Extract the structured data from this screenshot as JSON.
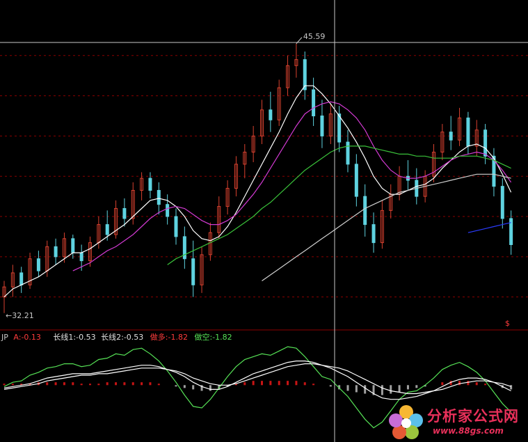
{
  "colors": {
    "background": "#000000",
    "grid": "#8b0000",
    "candle_up": "#d8412f",
    "candle_down": "#5fd3e0",
    "ma_white": "#ffffff",
    "ma_magenta": "#d23ad2",
    "ma_green": "#3ac23a",
    "ma_long": "#d0d0d0",
    "ma_blue": "#2b3cff",
    "macd_white": "#ffffff",
    "macd_green": "#56e256",
    "macd_red": "#ff2020",
    "bar_up": "#c81414",
    "bar_down": "#a0a0a0",
    "crosshair": "#c8c8c8",
    "ind_name": "#c8c8c8",
    "ind_red": "#ff3c3c",
    "ind_white": "#e0e0e0",
    "ind_green": "#56e256"
  },
  "price_labels": {
    "high": "45.59",
    "low": "←32.21",
    "marker": "$"
  },
  "indicator": {
    "name": "JP",
    "a_label": "A:",
    "a_value": "-0.13",
    "long1_label": "长线1:",
    "long1_value": "-0.53",
    "long2_label": "长线2:",
    "long2_value": "-0.53",
    "long_pos_label": "做多:",
    "long_pos_value": "-1.82",
    "short_pos_label": "做空:",
    "short_pos_value": "-1.82"
  },
  "logo": {
    "name": "分析家公式网",
    "url": "www.88gs.com",
    "icon": "flower-logo-icon"
  },
  "chart_data": [
    {
      "type": "candlestick",
      "title": "",
      "ylim": [
        31.5,
        47.0
      ],
      "price_high": 45.59,
      "price_low": 32.21,
      "candles": [
        [
          33.0,
          33.8,
          32.2,
          33.5
        ],
        [
          33.5,
          34.6,
          33.0,
          34.2
        ],
        [
          34.2,
          34.5,
          33.2,
          33.6
        ],
        [
          33.6,
          35.2,
          33.4,
          34.9
        ],
        [
          34.9,
          35.3,
          34.0,
          34.3
        ],
        [
          34.3,
          35.8,
          34.0,
          35.5
        ],
        [
          35.5,
          35.9,
          34.6,
          35.0
        ],
        [
          35.0,
          36.2,
          34.7,
          35.9
        ],
        [
          35.9,
          36.1,
          34.9,
          35.2
        ],
        [
          35.2,
          35.6,
          34.3,
          34.8
        ],
        [
          34.8,
          36.0,
          34.5,
          35.7
        ],
        [
          35.7,
          37.0,
          35.4,
          36.6
        ],
        [
          36.6,
          37.3,
          35.8,
          36.1
        ],
        [
          36.1,
          37.8,
          35.9,
          37.4
        ],
        [
          37.4,
          37.9,
          36.5,
          36.9
        ],
        [
          36.9,
          38.7,
          36.6,
          38.3
        ],
        [
          38.3,
          39.2,
          37.8,
          38.9
        ],
        [
          38.9,
          39.2,
          37.9,
          38.3
        ],
        [
          38.3,
          38.7,
          37.1,
          37.6
        ],
        [
          37.6,
          38.1,
          36.6,
          37.0
        ],
        [
          37.0,
          37.4,
          35.6,
          36.0
        ],
        [
          36.0,
          36.5,
          34.4,
          34.9
        ],
        [
          34.9,
          35.8,
          33.0,
          33.6
        ],
        [
          33.6,
          35.5,
          33.2,
          35.1
        ],
        [
          35.1,
          36.7,
          34.8,
          36.2
        ],
        [
          36.2,
          38.0,
          35.9,
          37.5
        ],
        [
          37.5,
          38.8,
          37.1,
          38.4
        ],
        [
          38.4,
          40.0,
          38.0,
          39.6
        ],
        [
          39.6,
          40.6,
          38.9,
          40.2
        ],
        [
          40.2,
          41.5,
          39.7,
          41.0
        ],
        [
          41.0,
          42.8,
          40.6,
          42.3
        ],
        [
          42.3,
          43.2,
          41.2,
          41.8
        ],
        [
          41.8,
          43.8,
          41.5,
          43.4
        ],
        [
          43.4,
          45.0,
          43.0,
          44.5
        ],
        [
          44.5,
          45.59,
          43.9,
          44.8
        ],
        [
          44.8,
          45.2,
          42.8,
          43.3
        ],
        [
          43.3,
          43.9,
          41.5,
          42.0
        ],
        [
          42.0,
          42.8,
          40.4,
          41.0
        ],
        [
          41.0,
          42.6,
          40.6,
          42.1
        ],
        [
          42.1,
          42.5,
          40.2,
          40.7
        ],
        [
          40.7,
          41.3,
          39.2,
          39.6
        ],
        [
          39.6,
          40.1,
          37.5,
          38.0
        ],
        [
          38.0,
          38.6,
          36.0,
          36.6
        ],
        [
          36.6,
          37.2,
          35.2,
          35.7
        ],
        [
          35.7,
          37.8,
          35.4,
          37.3
        ],
        [
          37.3,
          38.6,
          36.9,
          38.1
        ],
        [
          38.1,
          39.5,
          37.8,
          39.0
        ],
        [
          39.0,
          39.8,
          38.3,
          38.8
        ],
        [
          38.8,
          39.4,
          37.6,
          38.0
        ],
        [
          38.0,
          39.3,
          37.7,
          39.0
        ],
        [
          39.0,
          40.6,
          38.7,
          40.2
        ],
        [
          40.2,
          41.6,
          39.8,
          41.2
        ],
        [
          41.2,
          42.0,
          40.3,
          40.8
        ],
        [
          40.8,
          42.4,
          40.5,
          41.9
        ],
        [
          41.9,
          42.2,
          40.1,
          40.5
        ],
        [
          40.5,
          41.8,
          40.0,
          41.3
        ],
        [
          41.3,
          41.6,
          39.6,
          40.0
        ],
        [
          40.0,
          40.4,
          38.0,
          38.5
        ],
        [
          38.5,
          38.9,
          36.4,
          36.9
        ],
        [
          36.9,
          37.3,
          35.1,
          35.6
        ]
      ],
      "moving_averages": [
        {
          "color": "ma_white",
          "values": [
            33.0,
            33.4,
            33.6,
            33.8,
            34.0,
            34.3,
            34.6,
            34.9,
            35.2,
            35.2,
            35.4,
            35.7,
            36.0,
            36.3,
            36.6,
            37.0,
            37.4,
            37.8,
            37.9,
            37.8,
            37.5,
            37.0,
            36.3,
            35.9,
            35.8,
            36.0,
            36.5,
            37.2,
            38.0,
            38.8,
            39.6,
            40.4,
            41.2,
            42.1,
            42.9,
            43.5,
            43.5,
            43.1,
            42.6,
            42.0,
            41.4,
            40.7,
            39.9,
            39.0,
            38.4,
            38.1,
            38.1,
            38.3,
            38.5,
            38.6,
            38.9,
            39.4,
            39.8,
            40.2,
            40.5,
            40.6,
            40.4,
            39.9,
            39.1,
            38.2
          ]
        },
        {
          "color": "ma_magenta",
          "values": [
            null,
            null,
            null,
            null,
            null,
            null,
            null,
            null,
            34.3,
            34.5,
            34.7,
            35.0,
            35.3,
            35.5,
            35.8,
            36.1,
            36.5,
            36.9,
            37.2,
            37.4,
            37.5,
            37.4,
            37.1,
            36.8,
            36.6,
            36.6,
            36.8,
            37.1,
            37.6,
            38.1,
            38.7,
            39.4,
            40.1,
            40.8,
            41.5,
            42.1,
            42.4,
            42.6,
            42.7,
            42.6,
            42.3,
            41.9,
            41.3,
            40.5,
            39.8,
            39.3,
            39.0,
            38.9,
            38.9,
            39.0,
            39.2,
            39.5,
            39.8,
            40.0,
            40.1,
            40.2,
            40.1,
            39.8,
            39.3,
            38.7
          ]
        },
        {
          "color": "ma_green",
          "values": [
            null,
            null,
            null,
            null,
            null,
            null,
            null,
            null,
            null,
            null,
            null,
            null,
            null,
            null,
            null,
            null,
            null,
            null,
            null,
            34.6,
            34.9,
            35.1,
            35.3,
            35.5,
            35.7,
            35.9,
            36.1,
            36.4,
            36.7,
            37.0,
            37.4,
            37.7,
            38.1,
            38.5,
            38.9,
            39.3,
            39.6,
            39.9,
            40.2,
            40.4,
            40.5,
            40.5,
            40.5,
            40.4,
            40.3,
            40.2,
            40.1,
            40.1,
            40.0,
            40.0,
            39.9,
            39.9,
            39.9,
            40.0,
            40.0,
            40.0,
            39.9,
            39.8,
            39.6,
            39.4
          ]
        },
        {
          "color": "ma_long",
          "values": [
            null,
            null,
            null,
            null,
            null,
            null,
            null,
            null,
            null,
            null,
            null,
            null,
            null,
            null,
            null,
            null,
            null,
            null,
            null,
            null,
            null,
            null,
            null,
            null,
            null,
            null,
            null,
            null,
            null,
            null,
            33.8,
            34.1,
            34.4,
            34.7,
            35.0,
            35.3,
            35.6,
            35.9,
            36.2,
            36.5,
            36.8,
            37.1,
            37.4,
            37.6,
            37.8,
            38.0,
            38.2,
            38.3,
            38.4,
            38.5,
            38.6,
            38.7,
            38.8,
            38.9,
            39.0,
            39.1,
            39.1,
            39.1,
            39.0,
            38.9
          ]
        },
        {
          "color": "ma_blue",
          "values": [
            null,
            null,
            null,
            null,
            null,
            null,
            null,
            null,
            null,
            null,
            null,
            null,
            null,
            null,
            null,
            null,
            null,
            null,
            null,
            null,
            null,
            null,
            null,
            null,
            null,
            null,
            null,
            null,
            null,
            null,
            null,
            null,
            null,
            null,
            null,
            null,
            null,
            null,
            null,
            null,
            null,
            null,
            null,
            null,
            null,
            null,
            null,
            null,
            null,
            null,
            null,
            null,
            null,
            null,
            36.2,
            36.3,
            36.4,
            36.5,
            36.6,
            36.7
          ]
        }
      ]
    },
    {
      "type": "line",
      "title": "JP",
      "ylim": [
        -4.0,
        3.0
      ],
      "series": [
        {
          "name": "A",
          "color": "macd_green",
          "values": [
            -0.1,
            0.2,
            0.3,
            0.7,
            0.9,
            1.2,
            1.3,
            1.5,
            1.5,
            1.3,
            1.4,
            1.8,
            1.9,
            2.2,
            2.1,
            2.5,
            2.6,
            2.2,
            1.7,
            1.0,
            0.2,
            -0.7,
            -1.5,
            -1.6,
            -1.0,
            -0.2,
            0.6,
            1.3,
            1.8,
            2.0,
            2.2,
            2.1,
            2.4,
            2.7,
            2.6,
            2.0,
            1.3,
            0.6,
            0.4,
            -0.2,
            -0.8,
            -1.6,
            -2.4,
            -3.0,
            -2.6,
            -1.8,
            -1.0,
            -0.5,
            -0.4,
            0.0,
            0.5,
            1.1,
            1.4,
            1.6,
            1.3,
            0.9,
            0.3,
            -0.5,
            -1.3,
            -1.9
          ]
        },
        {
          "name": "长线1",
          "color": "macd_white",
          "values": [
            -0.2,
            -0.1,
            0.0,
            0.1,
            0.3,
            0.5,
            0.6,
            0.7,
            0.8,
            0.8,
            0.8,
            0.9,
            1.0,
            1.1,
            1.2,
            1.3,
            1.4,
            1.4,
            1.3,
            1.1,
            0.9,
            0.6,
            0.2,
            -0.1,
            -0.3,
            -0.3,
            -0.1,
            0.2,
            0.5,
            0.8,
            1.0,
            1.2,
            1.4,
            1.6,
            1.7,
            1.7,
            1.6,
            1.4,
            1.2,
            0.9,
            0.6,
            0.2,
            -0.2,
            -0.6,
            -0.9,
            -1.0,
            -1.0,
            -0.9,
            -0.8,
            -0.6,
            -0.4,
            -0.1,
            0.2,
            0.4,
            0.5,
            0.5,
            0.4,
            0.2,
            -0.1,
            -0.4
          ]
        },
        {
          "name": "长线2",
          "color": "macd_white",
          "values": [
            -0.3,
            -0.2,
            -0.1,
            0.0,
            0.1,
            0.3,
            0.4,
            0.5,
            0.6,
            0.7,
            0.7,
            0.8,
            0.8,
            0.9,
            1.0,
            1.1,
            1.2,
            1.2,
            1.2,
            1.1,
            1.0,
            0.8,
            0.5,
            0.3,
            0.1,
            0.0,
            0.0,
            0.1,
            0.3,
            0.5,
            0.7,
            0.9,
            1.1,
            1.3,
            1.4,
            1.5,
            1.5,
            1.4,
            1.3,
            1.2,
            1.0,
            0.7,
            0.4,
            0.1,
            -0.2,
            -0.4,
            -0.5,
            -0.6,
            -0.6,
            -0.5,
            -0.4,
            -0.3,
            -0.1,
            0.1,
            0.2,
            0.3,
            0.3,
            0.2,
            0.1,
            -0.1
          ]
        }
      ],
      "bars": [
        0.1,
        0.1,
        0.1,
        0.1,
        0.2,
        0.2,
        0.2,
        0.2,
        0.2,
        0.1,
        0.1,
        0.1,
        0.2,
        0.2,
        0.2,
        0.2,
        0.2,
        0.2,
        0.1,
        0.0,
        -0.1,
        -0.2,
        -0.3,
        -0.4,
        -0.4,
        -0.3,
        -0.1,
        0.1,
        0.2,
        0.3,
        0.3,
        0.3,
        0.3,
        0.3,
        0.3,
        0.2,
        0.1,
        0.0,
        -0.1,
        -0.3,
        -0.4,
        -0.5,
        -0.6,
        -0.7,
        -0.7,
        -0.6,
        -0.5,
        -0.3,
        -0.2,
        -0.1,
        0.0,
        0.2,
        0.3,
        0.3,
        0.3,
        0.2,
        0.1,
        0.0,
        -0.2,
        -0.3
      ]
    }
  ]
}
